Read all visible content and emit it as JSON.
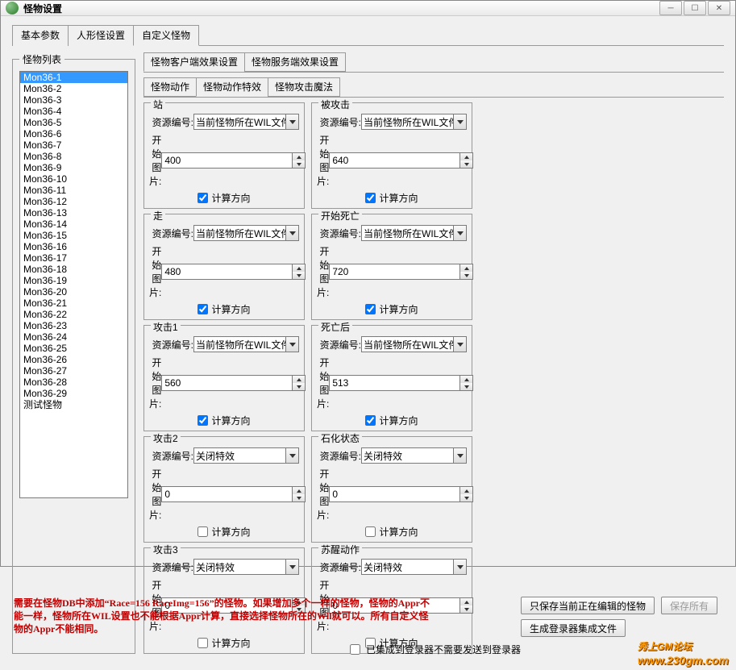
{
  "window": {
    "title": "怪物设置"
  },
  "tabs": {
    "basic": "基本参数",
    "humanoid": "人形怪设置",
    "custom": "自定义怪物"
  },
  "subtabs1": {
    "client": "怪物客户端效果设置",
    "server": "怪物服务端效果设置"
  },
  "subtabs2": {
    "action": "怪物动作",
    "actionfx": "怪物动作特效",
    "attackmagic": "怪物攻击魔法"
  },
  "list": {
    "legend": "怪物列表",
    "items": [
      "Mon36-1",
      "Mon36-2",
      "Mon36-3",
      "Mon36-4",
      "Mon36-5",
      "Mon36-6",
      "Mon36-7",
      "Mon36-8",
      "Mon36-9",
      "Mon36-10",
      "Mon36-11",
      "Mon36-12",
      "Mon36-13",
      "Mon36-14",
      "Mon36-15",
      "Mon36-16",
      "Mon36-17",
      "Mon36-18",
      "Mon36-19",
      "Mon36-20",
      "Mon36-21",
      "Mon36-22",
      "Mon36-23",
      "Mon36-24",
      "Mon36-25",
      "Mon36-26",
      "Mon36-27",
      "Mon36-28",
      "Mon36-29",
      "测试怪物"
    ],
    "selected": 0
  },
  "labels": {
    "resid": "资源编号:",
    "startimg": "开始图片:",
    "calcdir": "计算方向"
  },
  "res_options": {
    "wil": "当前怪物所在WIL文件",
    "off": "关闭特效"
  },
  "groups": [
    {
      "title": "站",
      "res": "wil",
      "start": "400",
      "calc": true
    },
    {
      "title": "被攻击",
      "res": "wil",
      "start": "640",
      "calc": true
    },
    {
      "title": "走",
      "res": "wil",
      "start": "480",
      "calc": true
    },
    {
      "title": "开始死亡",
      "res": "wil",
      "start": "720",
      "calc": true
    },
    {
      "title": "攻击1",
      "res": "wil",
      "start": "560",
      "calc": true
    },
    {
      "title": "死亡后",
      "res": "wil",
      "start": "513",
      "calc": true
    },
    {
      "title": "攻击2",
      "res": "off",
      "start": "0",
      "calc": false
    },
    {
      "title": "石化状态",
      "res": "off",
      "start": "0",
      "calc": false
    },
    {
      "title": "攻击3",
      "res": "off",
      "start": "0",
      "calc": false
    },
    {
      "title": "苏醒动作",
      "res": "off",
      "start": "0",
      "calc": false
    }
  ],
  "footer": {
    "warn": "需要在怪物DB中添加“Race=156 RaceImg=156”的怪物。如果增加多个一样的怪物，怪物的Appr不能一样，怪物所在WIL设置也不能根据Appr计算，直接选择怪物所在的Wil就可以。所有自定义怪物的Appr不能相同。",
    "integrated": "已集成到登录器不需要发送到登录器",
    "save_current": "只保存当前正在编辑的怪物",
    "save_all": "保存所有",
    "gen_login": "生成登录器集成文件"
  },
  "watermark": {
    "l1": "秀上GM论坛",
    "l2": "www.230gm.com"
  }
}
